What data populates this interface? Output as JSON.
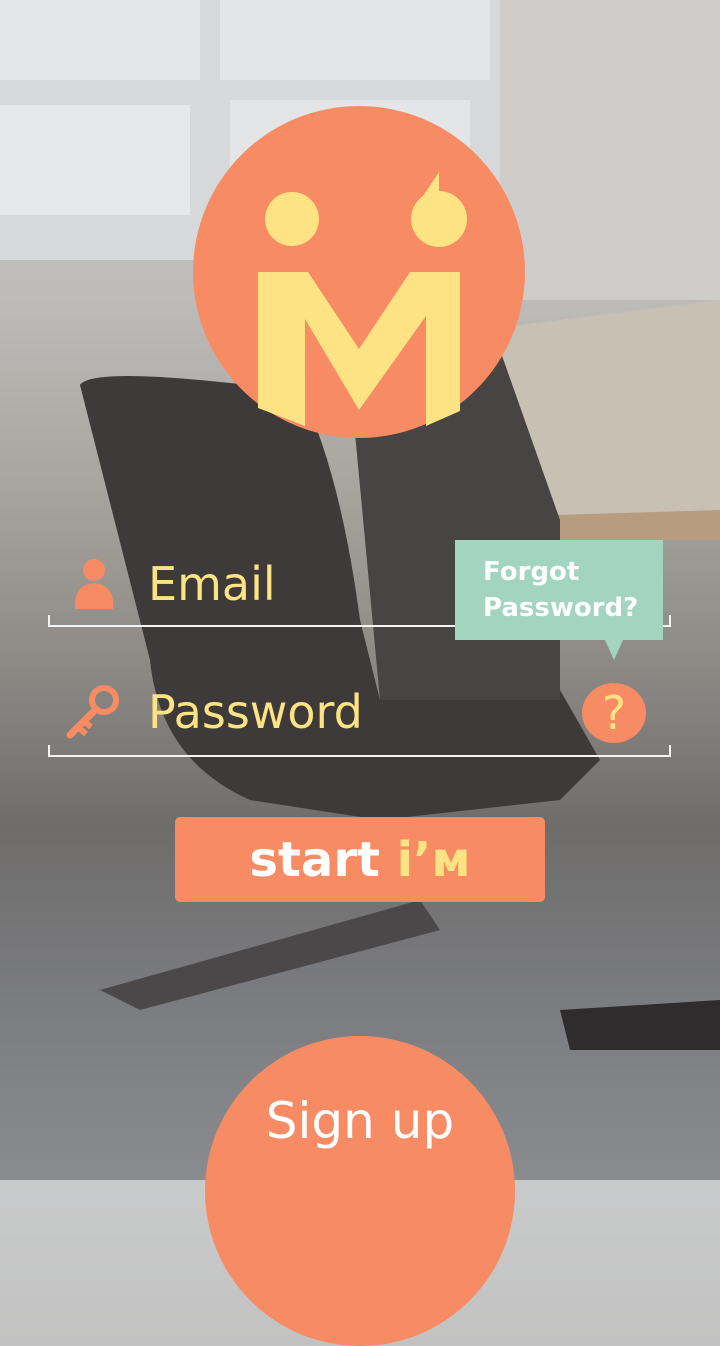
{
  "colors": {
    "accent": "#f78b63",
    "highlight": "#fde383",
    "tooltip": "#a3d4c0"
  },
  "logo": {
    "icon": "im-logo"
  },
  "email": {
    "placeholder": "Email",
    "icon": "user-icon"
  },
  "password": {
    "placeholder": "Password",
    "icon": "key-icon"
  },
  "forgot": {
    "line1": "Forgot",
    "line2": "Password?",
    "help_glyph": "?"
  },
  "start_button": {
    "label": "start",
    "brand": "i’м"
  },
  "signup_button": {
    "label": "Sign up"
  }
}
